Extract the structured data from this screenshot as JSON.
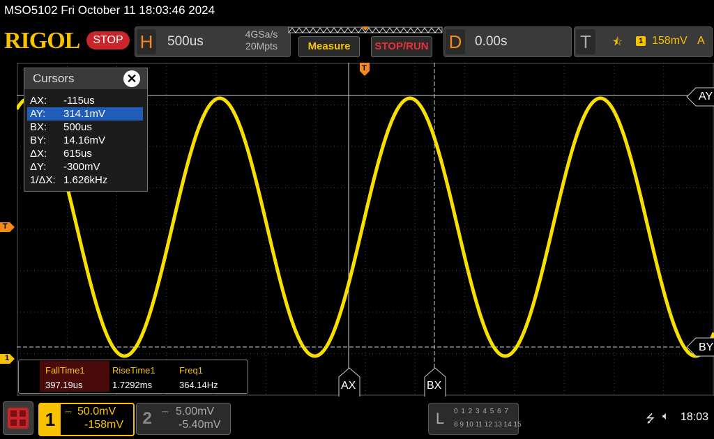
{
  "title_bar": {
    "text": "MSO5102  Fri October 11 18:03:46 2024"
  },
  "toolbar": {
    "brand": "RIGOL",
    "run_state": "STOP",
    "horizontal": {
      "letter": "H",
      "timebase": "500us",
      "sample_rate": "4GSa/s",
      "memory_depth": "20Mpts"
    },
    "measure_label": "Measure",
    "stop_run_label": "STOP/RUN",
    "delay": {
      "letter": "D",
      "value": "0.00s"
    },
    "trigger": {
      "letter": "T",
      "edge_symbol": "⯪",
      "channel": "1",
      "level": "158mV",
      "mode": "A"
    }
  },
  "markers": {
    "trigger_top": "T",
    "trigger_left": "T",
    "ch1_ground": "1",
    "ay": "AY",
    "by": "BY",
    "ax": "AX",
    "bx": "BX"
  },
  "cursors": {
    "title": "Cursors",
    "close_symbol": "✕",
    "rows": [
      {
        "label": "AX:",
        "value": "-115us"
      },
      {
        "label": "AY:",
        "value": "314.1mV"
      },
      {
        "label": "BX:",
        "value": "500us"
      },
      {
        "label": "BY:",
        "value": "14.16mV"
      },
      {
        "label": "ΔX:",
        "value": "615us"
      },
      {
        "label": "ΔY:",
        "value": "-300mV"
      },
      {
        "label": "1/ΔX:",
        "value": "1.626kHz"
      }
    ],
    "selected_row": 1
  },
  "measurements": [
    {
      "name": "FallTime1",
      "value": "397.19us"
    },
    {
      "name": "RiseTime1",
      "value": "1.7292ms"
    },
    {
      "name": "Freq1",
      "value": "364.14Hz"
    }
  ],
  "channels": {
    "ch1": {
      "num": "1",
      "scale": "50.0mV",
      "offset": "-158mV"
    },
    "ch2": {
      "num": "2",
      "scale": "5.00mV",
      "offset": "-5.40mV"
    }
  },
  "logic": {
    "letter": "L",
    "row1": "0 1 2 3  4 5 6 7",
    "row2": "8 9 10 11 12 13 14 15"
  },
  "status": {
    "usb_icon": "usb-icon",
    "volume_icon": "volume-mute-icon",
    "time": "18:03"
  },
  "colors": {
    "ch1": "#f7c200",
    "accent": "#f48a1c",
    "stop": "#c8262b",
    "selected": "#1f5db8"
  }
}
